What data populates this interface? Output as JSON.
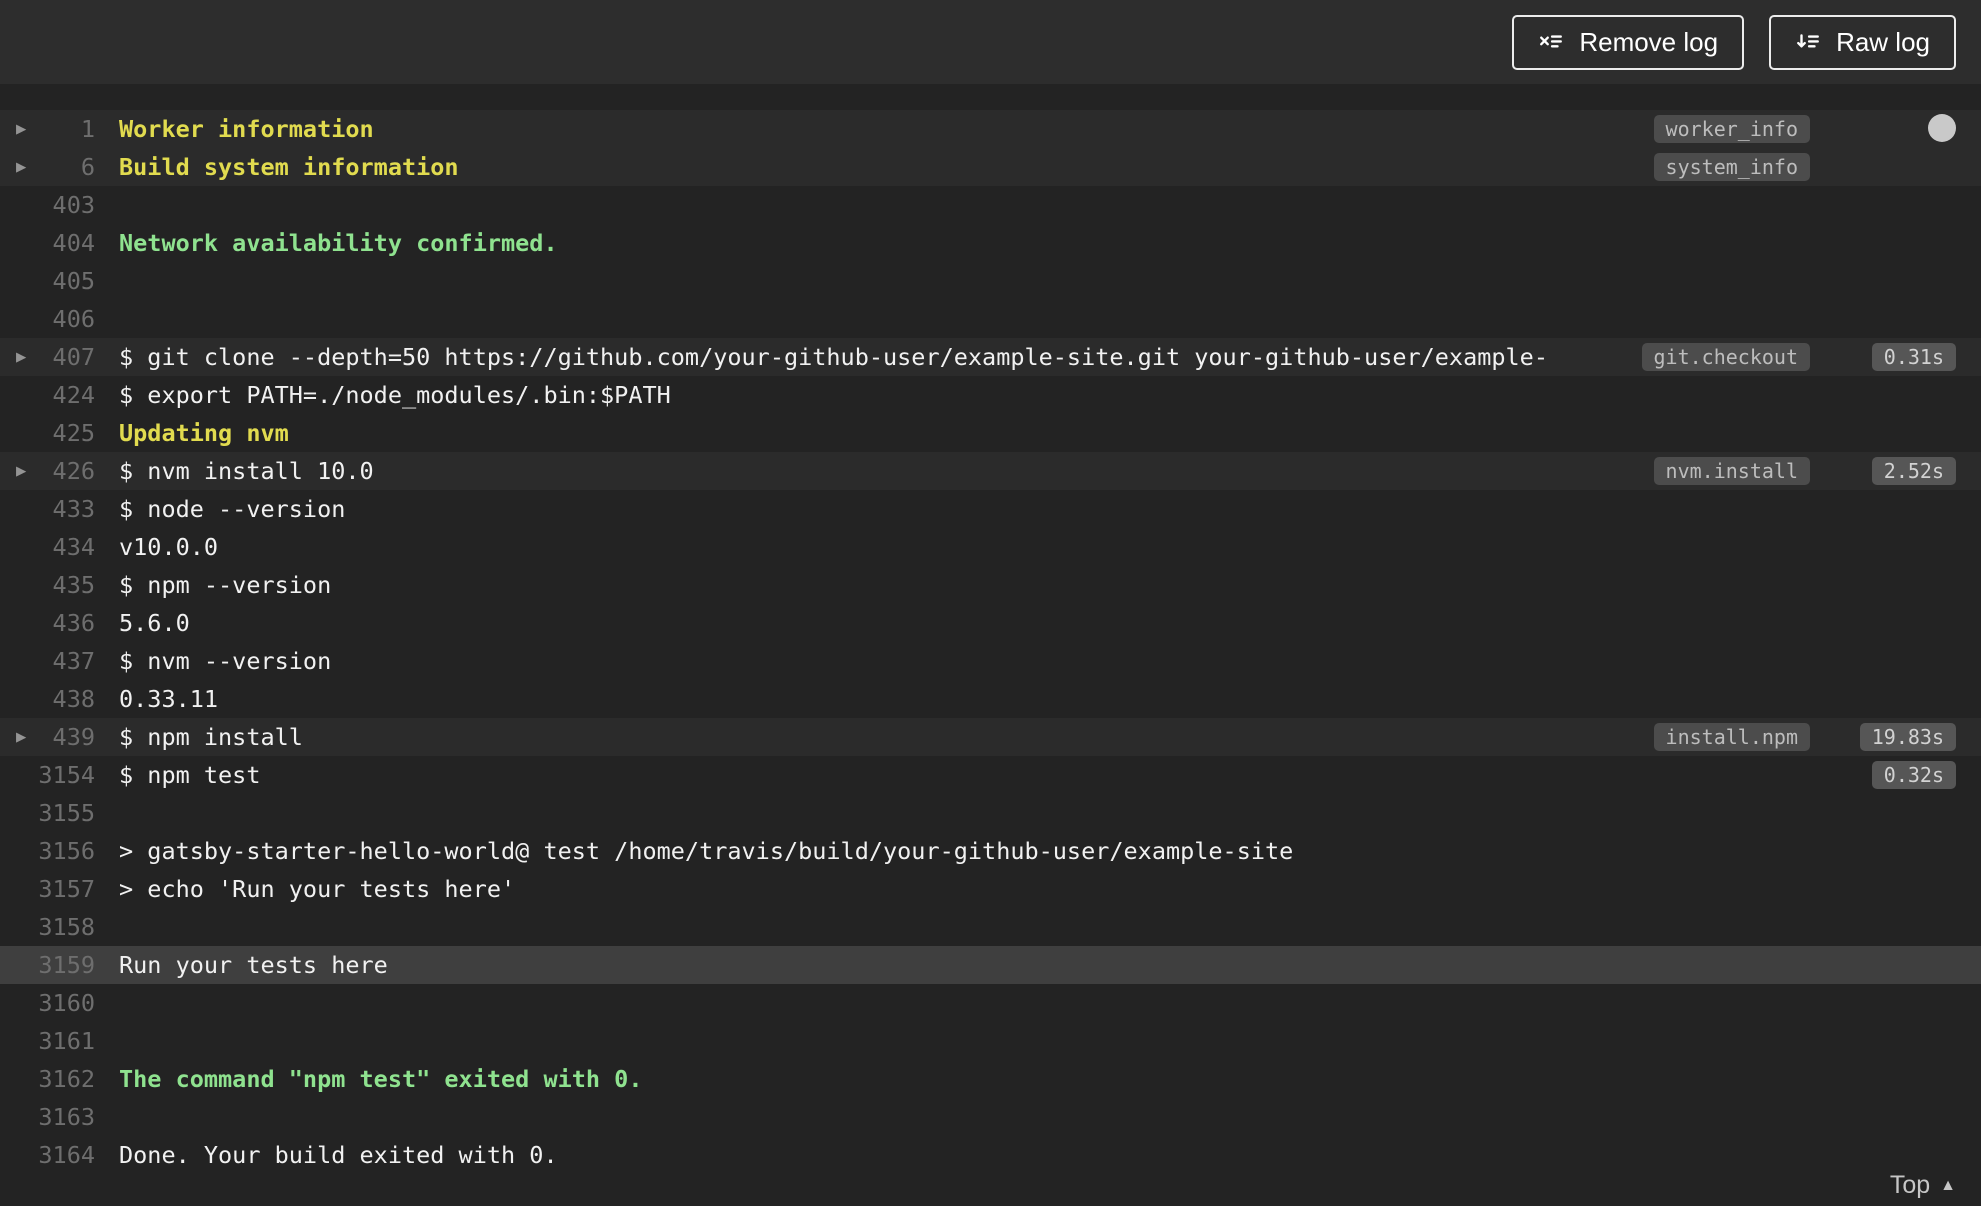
{
  "colors": {
    "toolbar_bg": "#2d2d2d",
    "log_bg": "#232323",
    "fold_row_bg": "#2b2b2b",
    "selected_row_bg": "#3f3f3f",
    "text": "#f1f1f1",
    "yellow": "#e1db4f",
    "green": "#8fe28f",
    "line_number": "#6e6e6e",
    "tag_bg": "#4c4c4c",
    "tag_text": "#bdbdbd",
    "duration_bg": "#565656",
    "duration_text": "#d2d2d2"
  },
  "toolbar": {
    "remove_log_label": "Remove log",
    "raw_log_label": "Raw log"
  },
  "log": {
    "top_link_label": "Top",
    "lines": [
      {
        "number": "1",
        "text": "Worker information",
        "style": "yellow",
        "fold": true,
        "tag": "worker_info"
      },
      {
        "number": "6",
        "text": "Build system information",
        "style": "yellow",
        "fold": true,
        "tag": "system_info"
      },
      {
        "number": "403",
        "text": ""
      },
      {
        "number": "404",
        "text": "Network availability confirmed.",
        "style": "green"
      },
      {
        "number": "405",
        "text": ""
      },
      {
        "number": "406",
        "text": ""
      },
      {
        "number": "407",
        "text": "$ git clone --depth=50 https://github.com/your-github-user/example-site.git your-github-user/example-",
        "fold": true,
        "tag": "git.checkout",
        "duration": "0.31s"
      },
      {
        "number": "424",
        "text": "$ export PATH=./node_modules/.bin:$PATH"
      },
      {
        "number": "425",
        "text": "Updating nvm",
        "style": "yellow"
      },
      {
        "number": "426",
        "text": "$ nvm install 10.0",
        "fold": true,
        "tag": "nvm.install",
        "duration": "2.52s"
      },
      {
        "number": "433",
        "text": "$ node --version"
      },
      {
        "number": "434",
        "text": "v10.0.0"
      },
      {
        "number": "435",
        "text": "$ npm --version"
      },
      {
        "number": "436",
        "text": "5.6.0"
      },
      {
        "number": "437",
        "text": "$ nvm --version"
      },
      {
        "number": "438",
        "text": "0.33.11"
      },
      {
        "number": "439",
        "text": "$ npm install",
        "fold": true,
        "tag": "install.npm",
        "duration": "19.83s"
      },
      {
        "number": "3154",
        "text": "$ npm test",
        "duration": "0.32s"
      },
      {
        "number": "3155",
        "text": ""
      },
      {
        "number": "3156",
        "text": "> gatsby-starter-hello-world@ test /home/travis/build/your-github-user/example-site"
      },
      {
        "number": "3157",
        "text": "> echo 'Run your tests here'"
      },
      {
        "number": "3158",
        "text": ""
      },
      {
        "number": "3159",
        "text": "Run your tests here",
        "highlight": "selected"
      },
      {
        "number": "3160",
        "text": ""
      },
      {
        "number": "3161",
        "text": ""
      },
      {
        "number": "3162",
        "text": "The command \"npm test\" exited with 0.",
        "style": "green"
      },
      {
        "number": "3163",
        "text": ""
      },
      {
        "number": "3164",
        "text": "Done. Your build exited with 0."
      }
    ]
  }
}
